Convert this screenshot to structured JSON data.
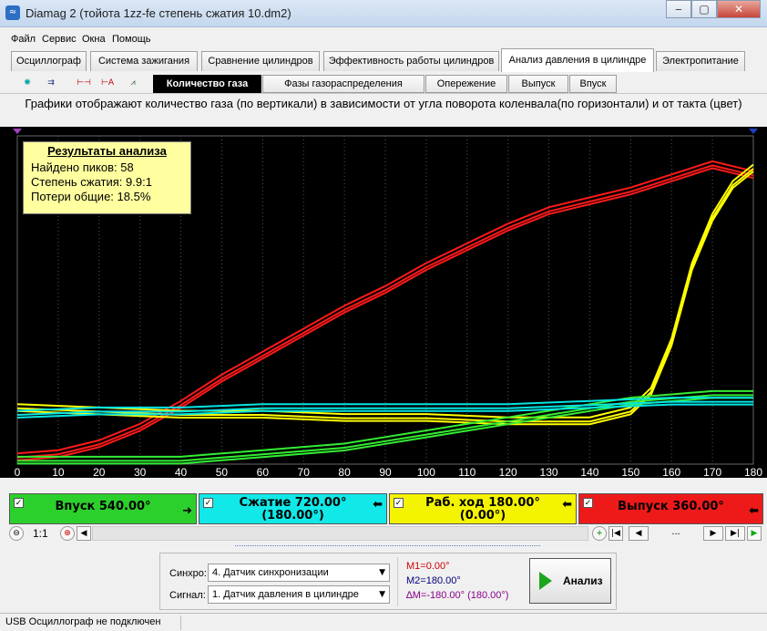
{
  "window": {
    "title": "Diamag 2 (тойота 1zz-fe степень сжатия 10.dm2)",
    "min": "‒",
    "max": "▢",
    "close": "✕"
  },
  "menu": [
    "Файл",
    "Сервис",
    "Окна",
    "Помощь"
  ],
  "main_tabs": [
    "Осциллограф",
    "Система зажигания",
    "Сравнение цилиндров",
    "Эффективность работы цилиндров",
    "Анализ давления в цилиндре",
    "Электропитание"
  ],
  "sub_tabs": [
    "Количество газа",
    "Фазы газораспределения",
    "Опережение",
    "Выпуск",
    "Впуск"
  ],
  "toolbar_icons": [
    "wave-tool-icon",
    "i124-tool-icon",
    "marker-tool-icon",
    "auto-tool-icon",
    "pv-tool-icon"
  ],
  "caption": "Графики отображают количество газа (по вертикали) в зависимости от угла поворота коленвала(по горизонтали) и от такта (цвет)",
  "results": {
    "title": "Результаты анализа",
    "peaks": "Найдено пиков: 58",
    "ratio": "Степень сжатия: 9.9:1",
    "losses": "Потери общие: 18.5%"
  },
  "chart_data": {
    "type": "line",
    "xlabel": "",
    "ylabel": "",
    "xlim": [
      0,
      180
    ],
    "x_ticks": [
      "0",
      "10",
      "20",
      "30",
      "40",
      "50",
      "60",
      "70",
      "80",
      "90",
      "100",
      "110",
      "120",
      "130",
      "140",
      "150",
      "160",
      "170",
      "180"
    ],
    "ylim": [
      0,
      100
    ],
    "grid": "vertical dotted",
    "series": [
      {
        "color": "#ff1a1a",
        "x": [
          0,
          10,
          20,
          30,
          40,
          50,
          60,
          70,
          80,
          90,
          100,
          110,
          120,
          130,
          140,
          150,
          160,
          170,
          180
        ],
        "y": [
          2,
          3,
          6,
          11,
          18,
          26,
          33,
          40,
          47,
          53,
          60,
          66,
          72,
          77,
          80,
          83,
          87,
          91,
          88
        ]
      },
      {
        "color": "#ffff00",
        "x": [
          0,
          20,
          40,
          60,
          80,
          100,
          120,
          140,
          150,
          155,
          160,
          165,
          170,
          175,
          180
        ],
        "y": [
          17,
          16,
          15,
          15,
          14,
          14,
          13,
          13,
          16,
          22,
          37,
          60,
          75,
          85,
          90
        ]
      },
      {
        "color": "#33ee33",
        "x": [
          0,
          10,
          20,
          30,
          40,
          50,
          60,
          70,
          80,
          90,
          100,
          110,
          120,
          130,
          140,
          150,
          160,
          170,
          180
        ],
        "y": [
          1,
          1,
          1,
          1,
          1,
          2,
          3,
          4,
          5,
          7,
          9,
          11,
          13,
          15,
          17,
          19,
          20,
          21,
          21
        ]
      },
      {
        "color": "#00e5e5",
        "x": [
          0,
          20,
          40,
          60,
          80,
          100,
          120,
          140,
          160,
          180
        ],
        "y": [
          15,
          16,
          16,
          17,
          17,
          17,
          17,
          18,
          19,
          19
        ]
      }
    ]
  },
  "phases": [
    {
      "label": "Впуск 540.00°",
      "sub": "",
      "arrow": "➜",
      "check": "✓",
      "color": "#2cd02c"
    },
    {
      "label": "Сжатие 720.00°",
      "sub": "(180.00°)",
      "arrow": "⬅",
      "check": "✓",
      "color": "#11e8e8"
    },
    {
      "label": "Раб. ход 180.00°",
      "sub": "(0.00°)",
      "arrow": "⬅",
      "check": "✓",
      "color": "#f4f400"
    },
    {
      "label": "Выпуск 360.00°",
      "sub": "",
      "arrow": "⬅",
      "check": "✓",
      "color": "#ee1a1a"
    }
  ],
  "zoom": {
    "scale": "1:1",
    "minus": "⊖",
    "plus": "⊕",
    "page": "..."
  },
  "sync": {
    "label_sync": "Синхро:",
    "value_sync": "4.  Датчик синхронизации",
    "label_signal": "Сигнал:",
    "value_signal": "1.  Датчик давления в цилиндре"
  },
  "markers": {
    "m1": "M1=0.00°",
    "m2": "M2=180.00°",
    "dm": "∆M=-180.00° (180.00°)"
  },
  "analyze_button": "Анализ",
  "status": "USB Осциллограф не подключен"
}
